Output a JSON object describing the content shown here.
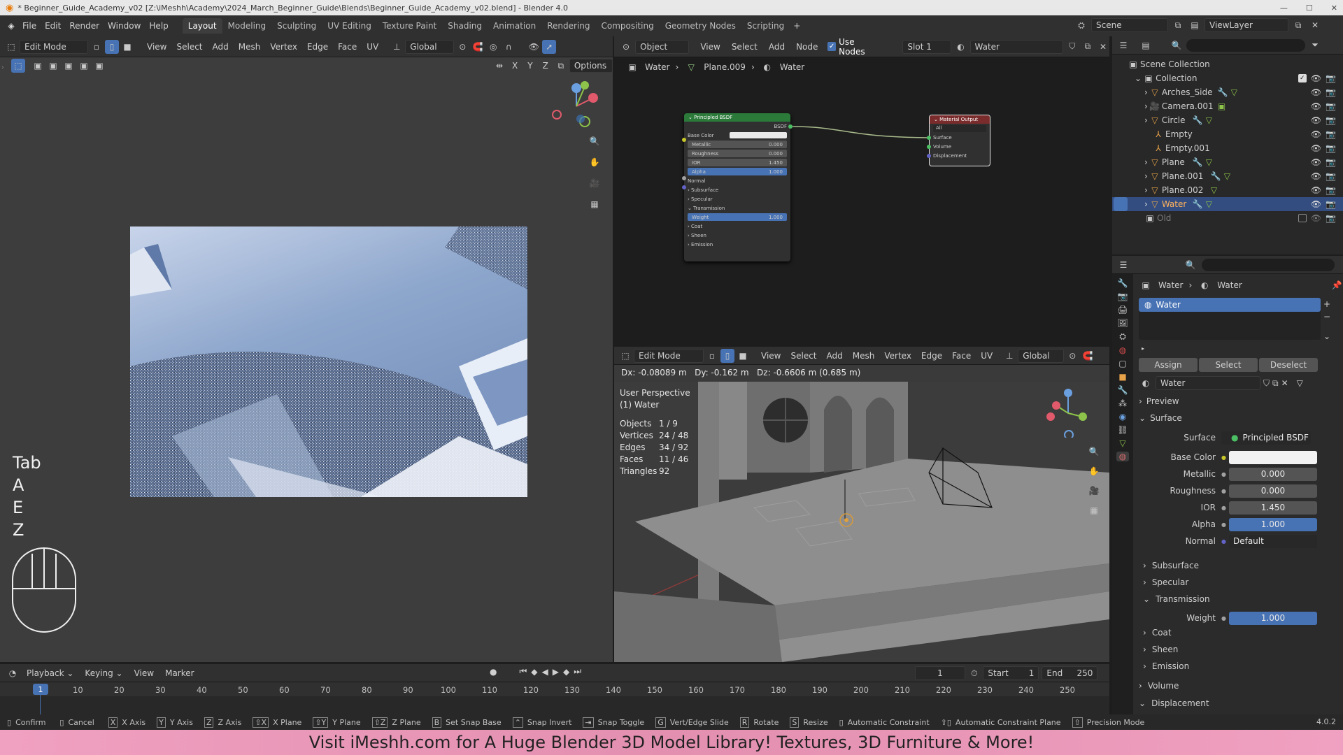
{
  "window": {
    "title": "* Beginner_Guide_Academy_v02 [Z:\\iMeshh\\Academy\\2024_March_Beginner_Guide\\Blends\\Beginner_Guide_Academy_v02.blend] - Blender 4.0"
  },
  "menu": [
    "File",
    "Edit",
    "Render",
    "Window",
    "Help"
  ],
  "workspaces": [
    "Layout",
    "Modeling",
    "Sculpting",
    "UV Editing",
    "Texture Paint",
    "Shading",
    "Animation",
    "Rendering",
    "Compositing",
    "Geometry Nodes",
    "Scripting"
  ],
  "scene": {
    "label": "Scene",
    "view_layer": "ViewLayer"
  },
  "left_view": {
    "mode": "Edit Mode",
    "menus": [
      "View",
      "Select",
      "Add",
      "Mesh",
      "Vertex",
      "Edge",
      "Face",
      "UV"
    ],
    "orientation": "Global",
    "axes": [
      "X",
      "Y",
      "Z"
    ],
    "options": "Options"
  },
  "keys": [
    "Tab",
    "A",
    "E",
    "Z"
  ],
  "node_editor": {
    "object": "Object",
    "menus": [
      "View",
      "Select",
      "Add",
      "Node"
    ],
    "use_nodes": "Use Nodes",
    "slot": "Slot 1",
    "material": "Water",
    "breadcrumb": [
      "Water",
      "Plane.009",
      "Water"
    ],
    "bsdf": {
      "title": "Principled BSDF",
      "out": "BSDF",
      "base_color": "Base Color",
      "metallic": [
        "Metallic",
        "0.000"
      ],
      "roughness": [
        "Roughness",
        "0.000"
      ],
      "ior": [
        "IOR",
        "1.450"
      ],
      "alpha": [
        "Alpha",
        "1.000"
      ],
      "normal": "Normal",
      "subsurface": "Subsurface",
      "specular": "Specular",
      "transmission": "Transmission",
      "weight": [
        "Weight",
        "1.000"
      ],
      "coat": "Coat",
      "sheen": "Sheen",
      "emission": "Emission"
    },
    "output": {
      "title": "Material Output",
      "target": "All",
      "surface": "Surface",
      "volume": "Volume",
      "displacement": "Displacement"
    }
  },
  "viewport3d": {
    "mode": "Edit Mode",
    "menus": [
      "View",
      "Select",
      "Add",
      "Mesh",
      "Vertex",
      "Edge",
      "Face",
      "UV"
    ],
    "orientation": "Global",
    "delta": "Dx: -0.08089 m   Dy: -0.162 m   Dz: -0.6606 m (0.685 m)",
    "perspective": "User Perspective",
    "object": "(1) Water",
    "stats": [
      [
        "Objects",
        "1 / 9"
      ],
      [
        "Vertices",
        "24 / 48"
      ],
      [
        "Edges",
        "34 / 92"
      ],
      [
        "Faces",
        "11 / 46"
      ],
      [
        "Triangles",
        "92"
      ]
    ]
  },
  "outliner": {
    "root": "Scene Collection",
    "collection": "Collection",
    "items": [
      "Arches_Side",
      "Camera.001",
      "Circle",
      "Empty",
      "Empty.001",
      "Plane",
      "Plane.001",
      "Plane.002",
      "Water"
    ],
    "old": "Old"
  },
  "properties": {
    "breadcrumb": [
      "Water",
      "Water"
    ],
    "slot": "Water",
    "assign": "Assign",
    "select": "Select",
    "deselect": "Deselect",
    "material": "Water",
    "preview": "Preview",
    "surface_panel": "Surface",
    "rows": [
      [
        "Surface",
        "Principled BSDF"
      ],
      [
        "Base Color",
        ""
      ],
      [
        "Metallic",
        "0.000"
      ],
      [
        "Roughness",
        "0.000"
      ],
      [
        "IOR",
        "1.450"
      ],
      [
        "Alpha",
        "1.000"
      ],
      [
        "Normal",
        "Default"
      ]
    ],
    "subsurface": "Subsurface",
    "specular": "Specular",
    "transmission": "Transmission",
    "weight": [
      "Weight",
      "1.000"
    ],
    "coat": "Coat",
    "sheen": "Sheen",
    "emission": "Emission",
    "volume": "Volume",
    "displacement": "Displacement"
  },
  "timeline": {
    "menus": [
      "Playback",
      "Keying",
      "View",
      "Marker"
    ],
    "frame": "1",
    "start_label": "Start",
    "start": "1",
    "end_label": "End",
    "end": "250",
    "ticks": [
      "1",
      "10",
      "20",
      "30",
      "40",
      "50",
      "60",
      "70",
      "80",
      "90",
      "100",
      "110",
      "120",
      "130",
      "140",
      "150",
      "160",
      "170",
      "180",
      "190",
      "200",
      "210",
      "220",
      "230",
      "240",
      "250"
    ]
  },
  "statusbar": {
    "items": [
      "Confirm",
      "Cancel",
      "X Axis",
      "Y Axis",
      "Z Axis",
      "X Plane",
      "Y Plane",
      "Z Plane",
      "Set Snap Base",
      "Snap Invert",
      "Snap Toggle",
      "Vert/Edge Slide",
      "Rotate",
      "Resize",
      "Automatic Constraint",
      "Automatic Constraint Plane",
      "Precision Mode"
    ],
    "version": "4.0.2"
  },
  "banner": "Visit iMeshh.com for A Huge Blender 3D Model Library! Textures, 3D Furniture & More!",
  "colors": {
    "accent": "#4772b3",
    "selected": "#334d80",
    "node_header": "#2c7a3a",
    "banner": "#e38fb0"
  }
}
